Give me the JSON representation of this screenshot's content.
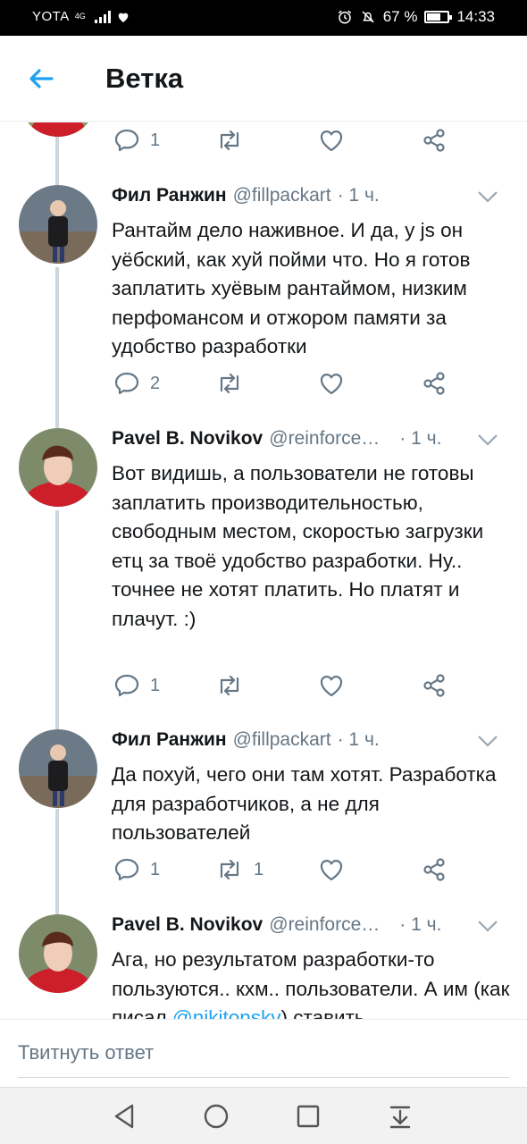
{
  "status_bar": {
    "carrier": "YOTA",
    "network": "4G",
    "battery": "67 %",
    "battery_level": 0.67,
    "time": "14:33"
  },
  "app_bar": {
    "title": "Ветка"
  },
  "top_partial": {
    "reply_count": "1"
  },
  "tweets": [
    {
      "name": "Фил Ранжин",
      "handle": "@fillpackart",
      "time": "· 1 ч.",
      "text": "Рантайм дело наживное. И да, у js он уёбский, как хуй пойми что. Но я готов заплатить хуёвым рантаймом, низким перфомансом и отжором памяти за удобство разработки",
      "replies": "2",
      "retweets": "",
      "likes": ""
    },
    {
      "name": "Pavel B. Novikov",
      "handle": "@reinforce…",
      "time": "· 1 ч.",
      "text": "Вот видишь, а пользователи не готовы заплатить производительностью, свободным местом, скоростью загрузки етц за твоё удобство разработки. Ну.. точнее не хотят платить. Но платят и плачут. :)",
      "replies": "1",
      "retweets": "",
      "likes": ""
    },
    {
      "name": "Фил Ранжин",
      "handle": "@fillpackart",
      "time": "· 1 ч.",
      "text": "Да похуй, чего они там хотят. Разработка для разработчиков, а не для пользователей",
      "replies": "1",
      "retweets": "1",
      "likes": ""
    },
    {
      "name": "Pavel B. Novikov",
      "handle": "@reinforce…",
      "time": "· 1 ч.",
      "text_before": "Ага, но результатом разработки-то пользуются.. кхм.. пользователи. А им (как писал ",
      "mention": "@nikitonskv",
      "text_after": ") ставить"
    }
  ],
  "reply_bar": {
    "placeholder": "Твитнуть ответ"
  },
  "icons": {
    "back": "arrow-left-icon",
    "reply": "speech-bubble-icon",
    "retweet": "retweet-icon",
    "like": "heart-icon",
    "share": "share-icon",
    "menu": "chevron-down-icon"
  },
  "colors": {
    "accent": "#1da1f2",
    "text": "#14171a",
    "muted": "#657786",
    "thread_line": "#ccd6dd"
  }
}
